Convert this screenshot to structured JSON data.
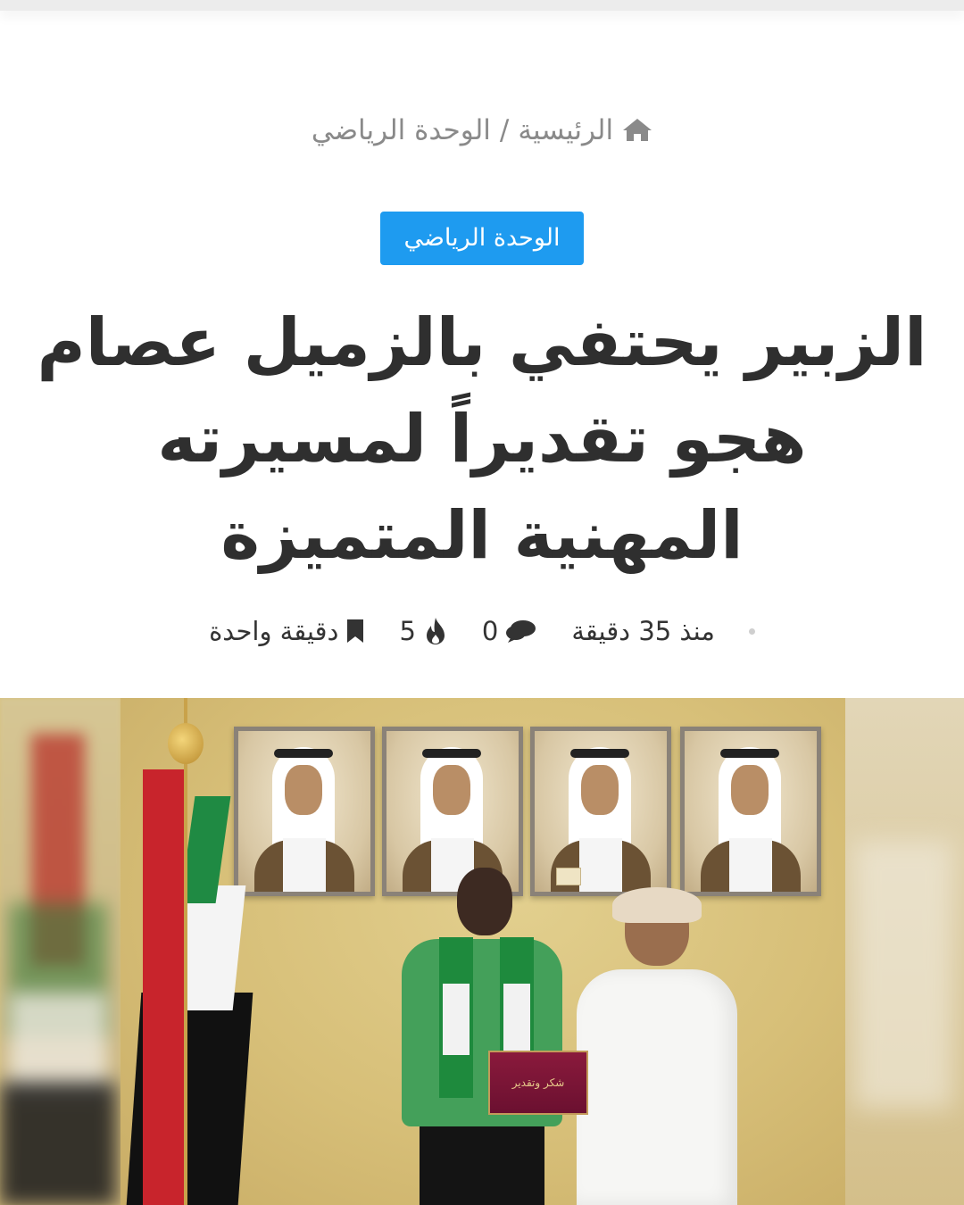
{
  "breadcrumb": {
    "home": "الرئيسية",
    "separator": "/",
    "current": "الوحدة الرياضي"
  },
  "category_badge": "الوحدة الرياضي",
  "headline": "الزبير يحتفي بالزميل عصام هجو تقديراً لمسيرته المهنية المتميزة",
  "meta": {
    "time": "منذ 35 دقيقة",
    "comments": "0",
    "views": "5",
    "reading_time": "دقيقة واحدة"
  },
  "image": {
    "plaque_text": "شكر وتقدير"
  },
  "colors": {
    "accent": "#1e9bf0",
    "headline": "#2f2f2f",
    "muted": "#8a8a8a"
  },
  "icons": [
    "home-icon",
    "comments-icon",
    "fire-icon",
    "bookmark-icon"
  ]
}
